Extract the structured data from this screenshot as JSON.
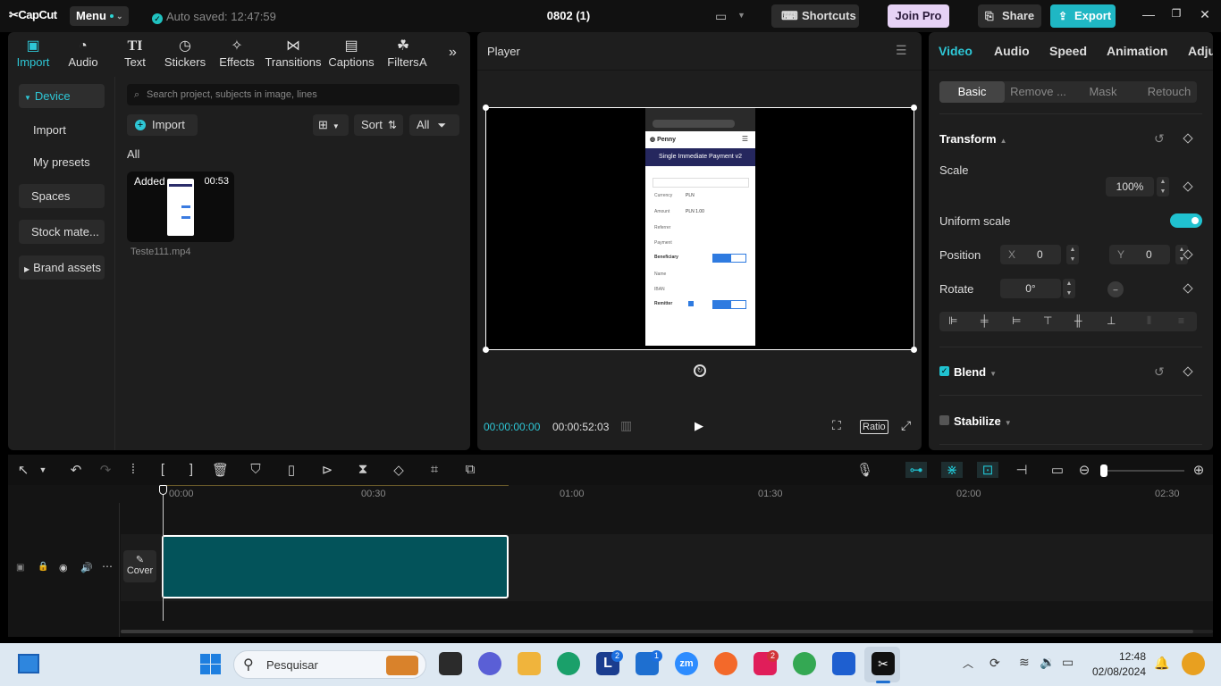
{
  "titlebar": {
    "logo": "CapCut",
    "menu_label": "Menu",
    "autosave": "Auto saved: 12:47:59",
    "project_title": "0802 (1)",
    "shortcuts": "Shortcuts",
    "join_pro": "Join Pro",
    "share": "Share",
    "export": "Export"
  },
  "top_nav": [
    {
      "label": "Import",
      "icon": "import-icon"
    },
    {
      "label": "Audio",
      "icon": "audio-icon"
    },
    {
      "label": "Text",
      "icon": "text-icon"
    },
    {
      "label": "Stickers",
      "icon": "stickers-icon"
    },
    {
      "label": "Effects",
      "icon": "effects-icon"
    },
    {
      "label": "Transitions",
      "icon": "transitions-icon"
    },
    {
      "label": "Captions",
      "icon": "captions-icon"
    },
    {
      "label": "Filters",
      "icon": "filters-icon"
    },
    {
      "label": "A",
      "icon": "adjust-icon"
    }
  ],
  "side_nav": [
    "Device",
    "Import",
    "My presets",
    "Spaces",
    "Stock mate...",
    "Brand assets"
  ],
  "media": {
    "search_placeholder": "Search project, subjects in image, lines",
    "import_label": "Import",
    "sort_label": "Sort",
    "all_filter": "All",
    "section_label": "All",
    "clip": {
      "badge": "Added",
      "duration": "00:53",
      "filename": "Teste111.mp4"
    }
  },
  "player": {
    "title": "Player",
    "current_time": "00:00:00:00",
    "total_time": "00:00:52:03",
    "ratio_label": "Ratio",
    "phone": {
      "brand": "Penny",
      "header": "Single Immediate Payment v2",
      "rows": [
        "Currency",
        "PLN",
        "Amount",
        "PLN 1.00",
        "Referrer",
        "Payment",
        "Beneficiary",
        "Name",
        "IBAN",
        "Remitter"
      ]
    }
  },
  "right": {
    "tabs": [
      "Video",
      "Audio",
      "Speed",
      "Animation",
      "Adju"
    ],
    "subtabs": [
      "Basic",
      "Remove ...",
      "Mask",
      "Retouch"
    ],
    "transform_title": "Transform",
    "scale_label": "Scale",
    "scale_value": "100%",
    "uniform_scale_label": "Uniform scale",
    "uniform_scale_on": 1,
    "position_label": "Position",
    "x_label": "X",
    "x_value": "0",
    "y_label": "Y",
    "y_value": "0",
    "rotate_label": "Rotate",
    "rotate_value": "0°",
    "blend_label": "Blend",
    "stabilize_label": "Stabilize"
  },
  "timeline": {
    "ticks": [
      "00:00",
      "00:30",
      "01:00",
      "01:30",
      "02:00",
      "02:30"
    ],
    "cover_label": "Cover"
  },
  "taskbar": {
    "search_placeholder": "Pesquisar",
    "time": "12:48",
    "date": "02/08/2024",
    "badge_l": "2",
    "badge_store": "1",
    "badge_slack": "2"
  },
  "colors": {
    "accent": "#2ec7d6",
    "export_bg": "#1fb7c4",
    "clip": "#03535a",
    "joinpro": "#e6d2f5"
  }
}
